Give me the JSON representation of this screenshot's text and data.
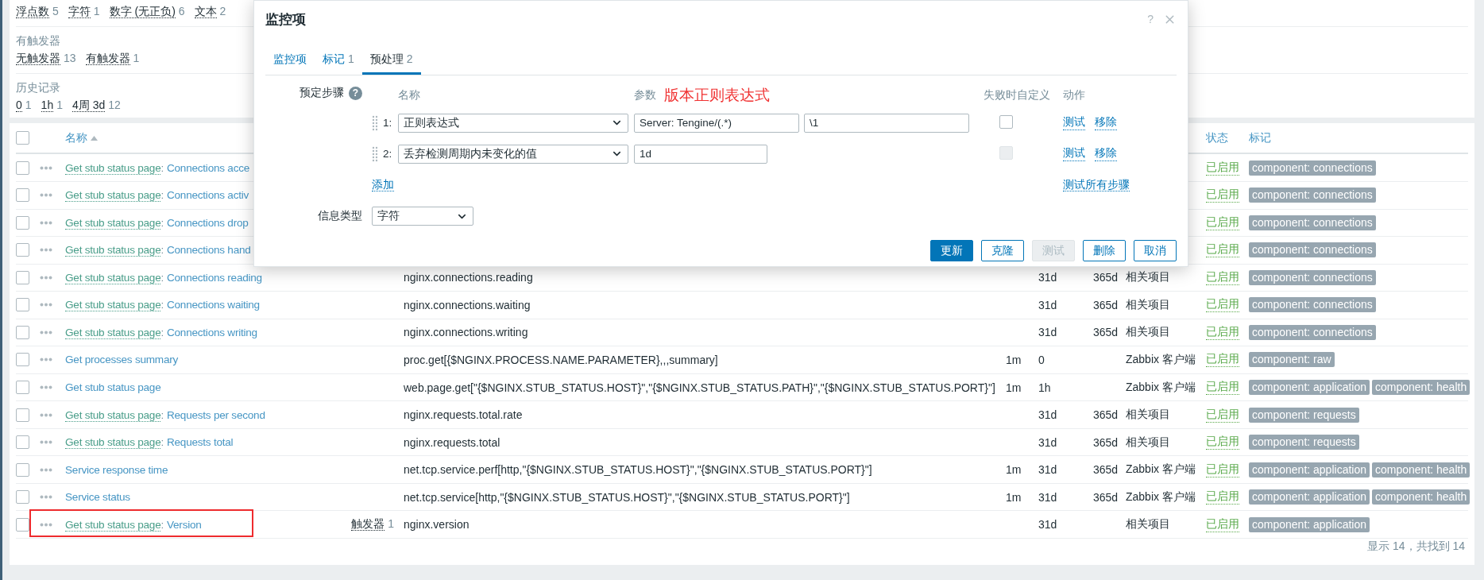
{
  "filter": {
    "groups": [
      {
        "items": [
          {
            "label": "浮点数",
            "count": "5"
          },
          {
            "label": "字符",
            "count": "1"
          },
          {
            "label": "数字 (无正负)",
            "count": "6"
          },
          {
            "label": "文本",
            "count": "2"
          }
        ]
      },
      {
        "heading": "有触发器",
        "items": [
          {
            "label": "无触发器",
            "count": "13"
          },
          {
            "label": "有触发器",
            "count": "1"
          }
        ]
      },
      {
        "heading": "历史记录",
        "items": [
          {
            "label": "0",
            "count": "1"
          },
          {
            "label": "1h",
            "count": "1"
          },
          {
            "label": "4周 3d",
            "count": "12"
          }
        ]
      }
    ]
  },
  "table": {
    "header_checked": false,
    "columns": [
      {
        "label": "名称",
        "sorted": true
      },
      {
        "label": "状态",
        "sorted": false
      },
      {
        "label": "标记",
        "sorted": false
      }
    ],
    "rows": [
      {
        "checked": false,
        "template": "Get stub status page",
        "sep": ":",
        "name": "Connections acce",
        "status": "已启用",
        "tags": [
          "component: connections"
        ]
      },
      {
        "checked": false,
        "template": "Get stub status page",
        "sep": ":",
        "name": "Connections activ",
        "status": "已启用",
        "tags": [
          "component: connections"
        ]
      },
      {
        "checked": false,
        "template": "Get stub status page",
        "sep": ":",
        "name": "Connections drop",
        "status": "已启用",
        "tags": [
          "component: connections"
        ]
      },
      {
        "checked": false,
        "template": "Get stub status page",
        "sep": ":",
        "name": "Connections hand",
        "status": "已启用",
        "tags": [
          "component: connections"
        ]
      },
      {
        "checked": false,
        "template": "Get stub status page",
        "sep": ":",
        "name": "Connections reading",
        "key": "nginx.connections.reading",
        "history": "31d",
        "trends": "365d",
        "type": "相关项目",
        "status": "已启用",
        "tags": [
          "component: connections"
        ]
      },
      {
        "checked": false,
        "template": "Get stub status page",
        "sep": ":",
        "name": "Connections waiting",
        "key": "nginx.connections.waiting",
        "history": "31d",
        "trends": "365d",
        "type": "相关项目",
        "status": "已启用",
        "tags": [
          "component: connections"
        ]
      },
      {
        "checked": false,
        "template": "Get stub status page",
        "sep": ":",
        "name": "Connections writing",
        "key": "nginx.connections.writing",
        "history": "31d",
        "trends": "365d",
        "type": "相关项目",
        "status": "已启用",
        "tags": [
          "component: connections"
        ]
      },
      {
        "checked": false,
        "name": "Get processes summary",
        "key": "proc.get[{$NGINX.PROCESS.NAME.PARAMETER},,,summary]",
        "interval": "1m",
        "history": "0",
        "type": "Zabbix 客户端",
        "status": "已启用",
        "tags": [
          "component: raw"
        ]
      },
      {
        "checked": false,
        "name": "Get stub status page",
        "key": "web.page.get[\"{$NGINX.STUB_STATUS.HOST}\",\"{$NGINX.STUB_STATUS.PATH}\",\"{$NGINX.STUB_STATUS.PORT}\"]",
        "interval": "1m",
        "history": "1h",
        "type": "Zabbix 客户端",
        "status": "已启用",
        "tags": [
          "component: application",
          "component: health"
        ]
      },
      {
        "checked": false,
        "template": "Get stub status page",
        "sep": ":",
        "name": "Requests per second",
        "key": "nginx.requests.total.rate",
        "history": "31d",
        "trends": "365d",
        "type": "相关项目",
        "status": "已启用",
        "tags": [
          "component: requests"
        ]
      },
      {
        "checked": false,
        "template": "Get stub status page",
        "sep": ":",
        "name": "Requests total",
        "key": "nginx.requests.total",
        "history": "31d",
        "trends": "365d",
        "type": "相关项目",
        "status": "已启用",
        "tags": [
          "component: requests"
        ]
      },
      {
        "checked": false,
        "name": "Service response time",
        "key": "net.tcp.service.perf[http,\"{$NGINX.STUB_STATUS.HOST}\",\"{$NGINX.STUB_STATUS.PORT}\"]",
        "interval": "1m",
        "history": "31d",
        "trends": "365d",
        "type": "Zabbix 客户端",
        "status": "已启用",
        "tags": [
          "component: application",
          "component: health"
        ]
      },
      {
        "checked": false,
        "name": "Service status",
        "key": "net.tcp.service[http,\"{$NGINX.STUB_STATUS.HOST}\",\"{$NGINX.STUB_STATUS.PORT}\"]",
        "interval": "1m",
        "history": "31d",
        "trends": "365d",
        "type": "Zabbix 客户端",
        "status": "已启用",
        "tags": [
          "component: application",
          "component: health"
        ]
      },
      {
        "checked": false,
        "highlighted": true,
        "template": "Get stub status page",
        "sep": ":",
        "name": "Version",
        "triggers": {
          "label": "触发器",
          "count": "1"
        },
        "key": "nginx.version",
        "history": "31d",
        "type": "相关项目",
        "status": "已启用",
        "tags": [
          "component: application"
        ]
      }
    ],
    "footer": "显示 14，共找到 14"
  },
  "dialog": {
    "title": "监控项",
    "help": "?",
    "tabs": [
      {
        "label": "监控项",
        "selected": false
      },
      {
        "label": "标记",
        "count": "1",
        "selected": false
      },
      {
        "label": "预处理",
        "count": "2",
        "selected": true
      }
    ],
    "steps_label": "预定步骤",
    "steps_help": "?",
    "step_columns": [
      "名称",
      "参数",
      "失败时自定义",
      "动作"
    ],
    "annotation": "版本正则表达式",
    "steps": [
      {
        "number": "1:",
        "type": "正则表达式",
        "params": [
          "Server: Tengine/(.*)",
          "\\1"
        ],
        "custom_on_fail": false,
        "fail_disabled": false,
        "actions": [
          "测试",
          "移除"
        ]
      },
      {
        "number": "2:",
        "type": "丢弃检测周期内未变化的值",
        "params": [
          "1d"
        ],
        "custom_on_fail": false,
        "fail_disabled": true,
        "actions": [
          "测试",
          "移除"
        ]
      }
    ],
    "add_link": "添加",
    "test_all": "测试所有步骤",
    "info_type": {
      "label": "信息类型",
      "value": "字符"
    },
    "buttons": [
      {
        "label": "更新",
        "kind": "primary",
        "disabled": false
      },
      {
        "label": "克隆",
        "kind": "secondary",
        "disabled": false
      },
      {
        "label": "测试",
        "kind": "secondary",
        "disabled": true
      },
      {
        "label": "删除",
        "kind": "secondary",
        "disabled": false
      },
      {
        "label": "取消",
        "kind": "secondary",
        "disabled": false
      }
    ]
  }
}
